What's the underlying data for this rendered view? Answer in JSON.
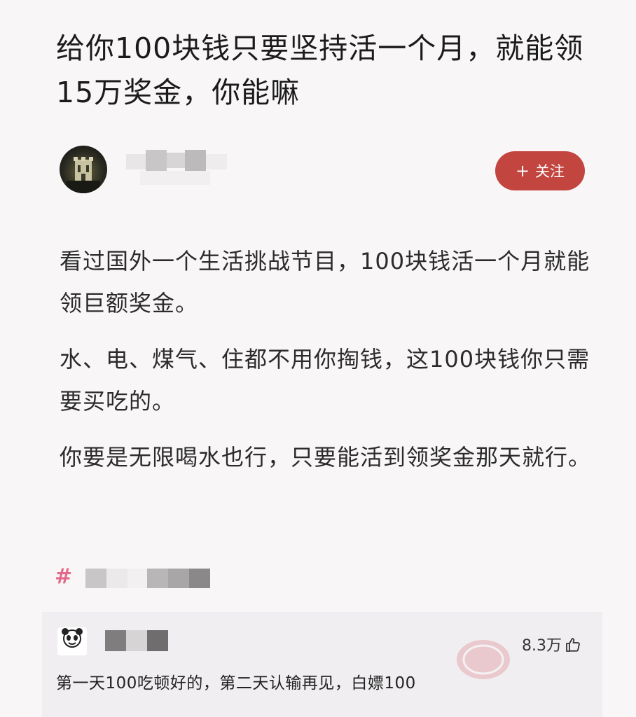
{
  "post": {
    "title": "给你100块钱只要坚持活一个月，就能领15万奖金，你能嘛",
    "paragraphs": [
      "看过国外一个生活挑战节目，100块钱活一个月就能领巨额奖金。",
      "水、电、煤气、住都不用你掏钱，这100块钱你只需要买吃的。",
      "你要是无限喝水也行，只要能活到领奖金那天就行。"
    ]
  },
  "author": {
    "follow_plus": "+",
    "follow_label": "关注"
  },
  "topic": {
    "hash_symbol": "#"
  },
  "comment": {
    "likes": "8.3万",
    "text": "第一天100吃顿好的，第二天认输再见，白嫖100"
  },
  "colors": {
    "follow_bg": "#c2453f",
    "hash": "#e06b8a",
    "background": "#f8f6f7"
  },
  "icons": {
    "like": "thumbs-up-icon",
    "avatar": "avatar",
    "watermark": "stamp-watermark"
  }
}
